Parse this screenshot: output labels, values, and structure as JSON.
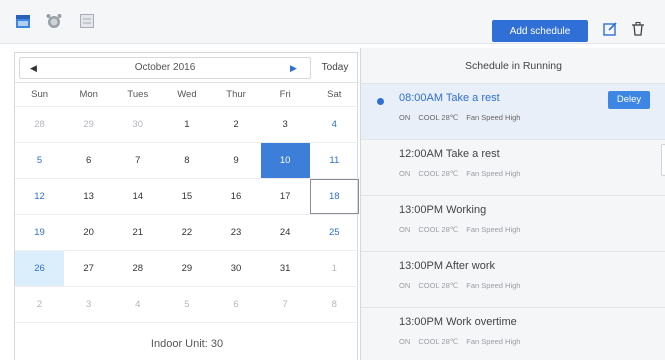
{
  "toolbar": {
    "add_schedule_label": "Add schedule"
  },
  "calendar": {
    "month_label": "October 2016",
    "today_label": "Today",
    "weekdays": [
      "Sun",
      "Mon",
      "Tues",
      "Wed",
      "Thur",
      "Fri",
      "Sat"
    ],
    "weeks": [
      [
        "28",
        "29",
        "30",
        "1",
        "2",
        "3",
        "4"
      ],
      [
        "5",
        "6",
        "7",
        "8",
        "9",
        "10",
        "11"
      ],
      [
        "12",
        "13",
        "14",
        "15",
        "16",
        "17",
        "18"
      ],
      [
        "19",
        "20",
        "21",
        "22",
        "23",
        "24",
        "25"
      ],
      [
        "26",
        "27",
        "28",
        "29",
        "30",
        "31",
        "1"
      ],
      [
        "2",
        "3",
        "4",
        "5",
        "6",
        "7",
        "8"
      ]
    ],
    "indoor_unit_label": "Indoor Unit: 30"
  },
  "schedule": {
    "title": "Schedule in Running",
    "delay_label": "Deley",
    "items": [
      {
        "title": "08:00AM Take a rest",
        "power": "ON",
        "mode": "COOL 28℃",
        "fan": "Fan Speed High"
      },
      {
        "title": "12:00AM Take a rest",
        "power": "ON",
        "mode": "COOL 28℃",
        "fan": "Fan Speed High"
      },
      {
        "title": "13:00PM Working",
        "power": "ON",
        "mode": "COOL 28℃",
        "fan": "Fan Speed High"
      },
      {
        "title": "13:00PM After work",
        "power": "ON",
        "mode": "COOL 28℃",
        "fan": "Fan Speed High"
      },
      {
        "title": "13:00PM Work overtime",
        "power": "ON",
        "mode": "COOL 28℃",
        "fan": "Fan Speed High"
      }
    ]
  },
  "colors": {
    "accent": "#2f6fd6",
    "selected_day": "#3d7ed8",
    "highlight_day": "#dbeefc"
  }
}
